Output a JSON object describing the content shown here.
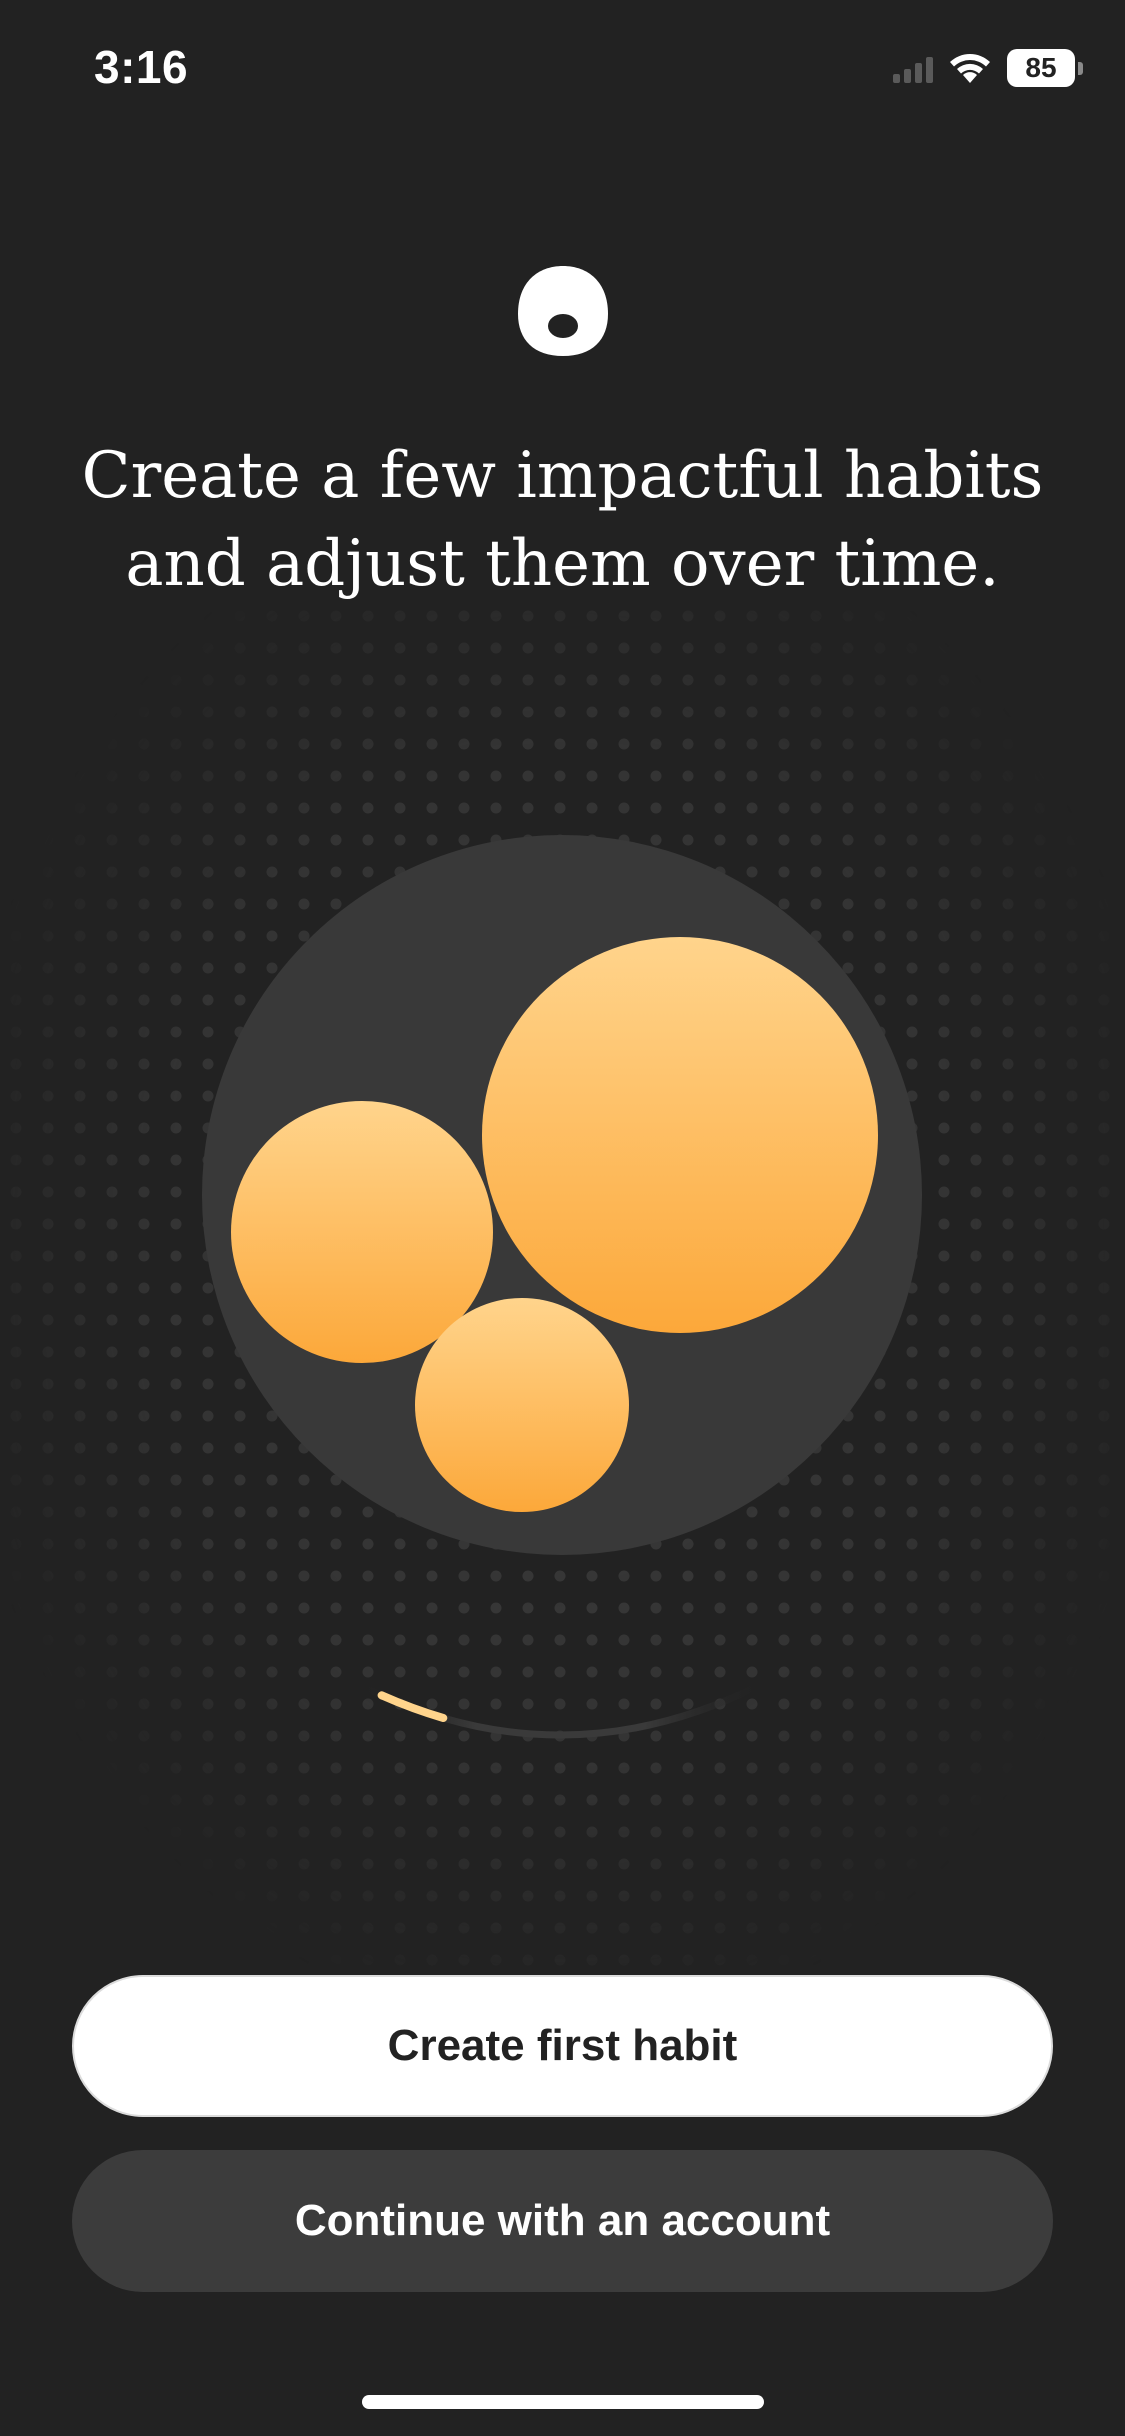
{
  "status_bar": {
    "time": "3:16",
    "battery_level": "85",
    "icons": [
      "signal-icon",
      "wifi-icon",
      "battery-icon"
    ]
  },
  "logo": {
    "icon": "app-logo-icon"
  },
  "headline": {
    "line1": "Create a few impactful habits",
    "line2": "and adjust them over time."
  },
  "illustration": {
    "icon": "habit-circles-illustration",
    "progress_fraction": 0.15
  },
  "buttons": {
    "primary_label": "Create first habit",
    "secondary_label": "Continue with an account"
  },
  "colors": {
    "background": "#222222",
    "accent_light": "#FFD48C",
    "accent_dark": "#FCA83A",
    "plate": "#393939",
    "secondary_button": "#3C3C3C"
  }
}
